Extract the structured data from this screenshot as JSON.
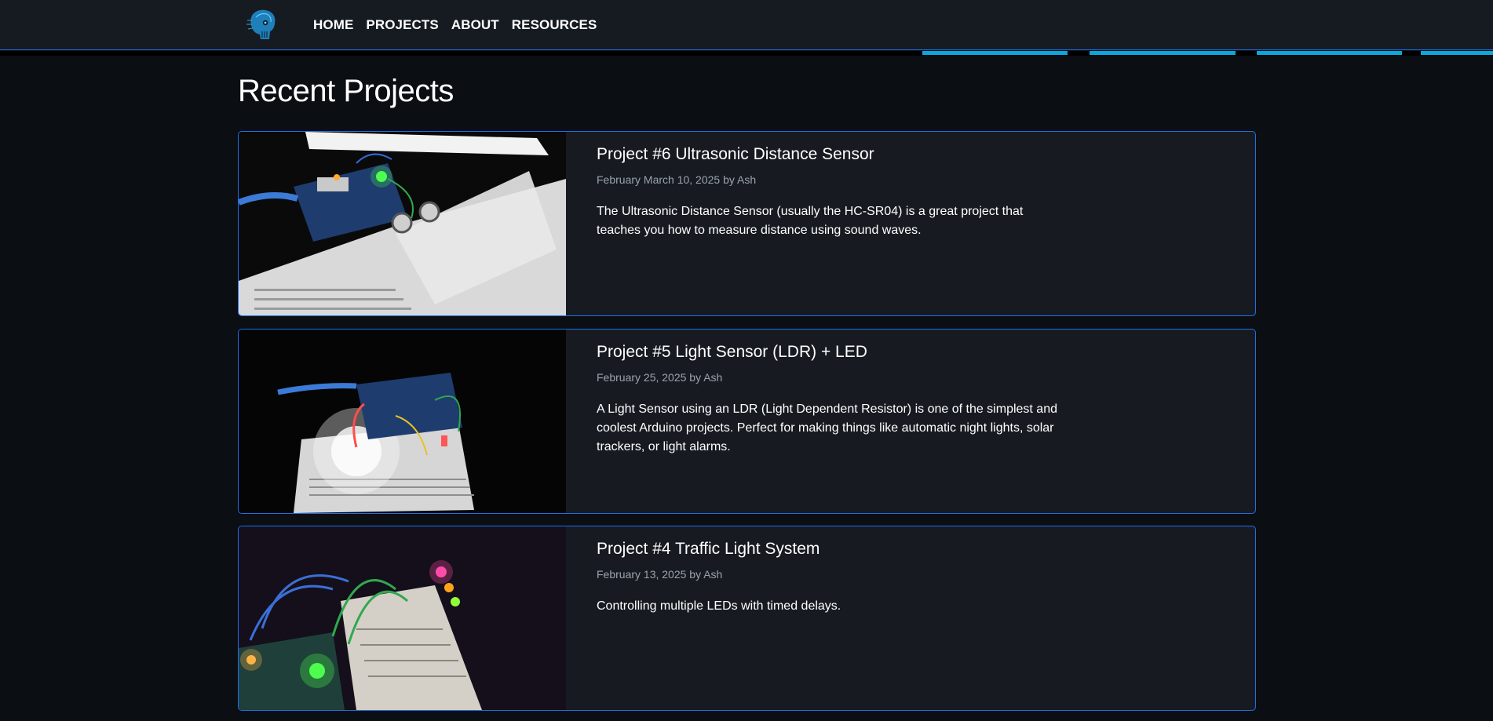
{
  "nav": {
    "items": [
      "HOME",
      "PROJECTS",
      "ABOUT",
      "RESOURCES"
    ]
  },
  "logo": {
    "icon": "robot-skull-icon"
  },
  "page": {
    "title": "Recent Projects"
  },
  "projects": [
    {
      "title": "Project #6 Ultrasonic Distance Sensor",
      "meta": "February March 10, 2025 by Ash",
      "description": "The Ultrasonic Distance Sensor (usually the HC-SR04) is a great project that teaches you how to measure distance using sound waves."
    },
    {
      "title": "Project #5 Light Sensor (LDR) + LED",
      "meta": "February 25, 2025 by Ash",
      "description": "A Light Sensor using an LDR (Light Dependent Resistor) is one of the simplest and coolest Arduino projects. Perfect for making things like automatic night lights, solar trackers, or light alarms."
    },
    {
      "title": "Project #4 Traffic Light System",
      "meta": "February 13, 2025 by Ash",
      "description": "Controlling multiple LEDs with timed delays."
    }
  ],
  "colors": {
    "background": "#0b0e12",
    "card": "#171b21",
    "accent_border": "#1f6feb",
    "strip": "#0ea5d8",
    "meta_text": "#9aa3ad"
  }
}
